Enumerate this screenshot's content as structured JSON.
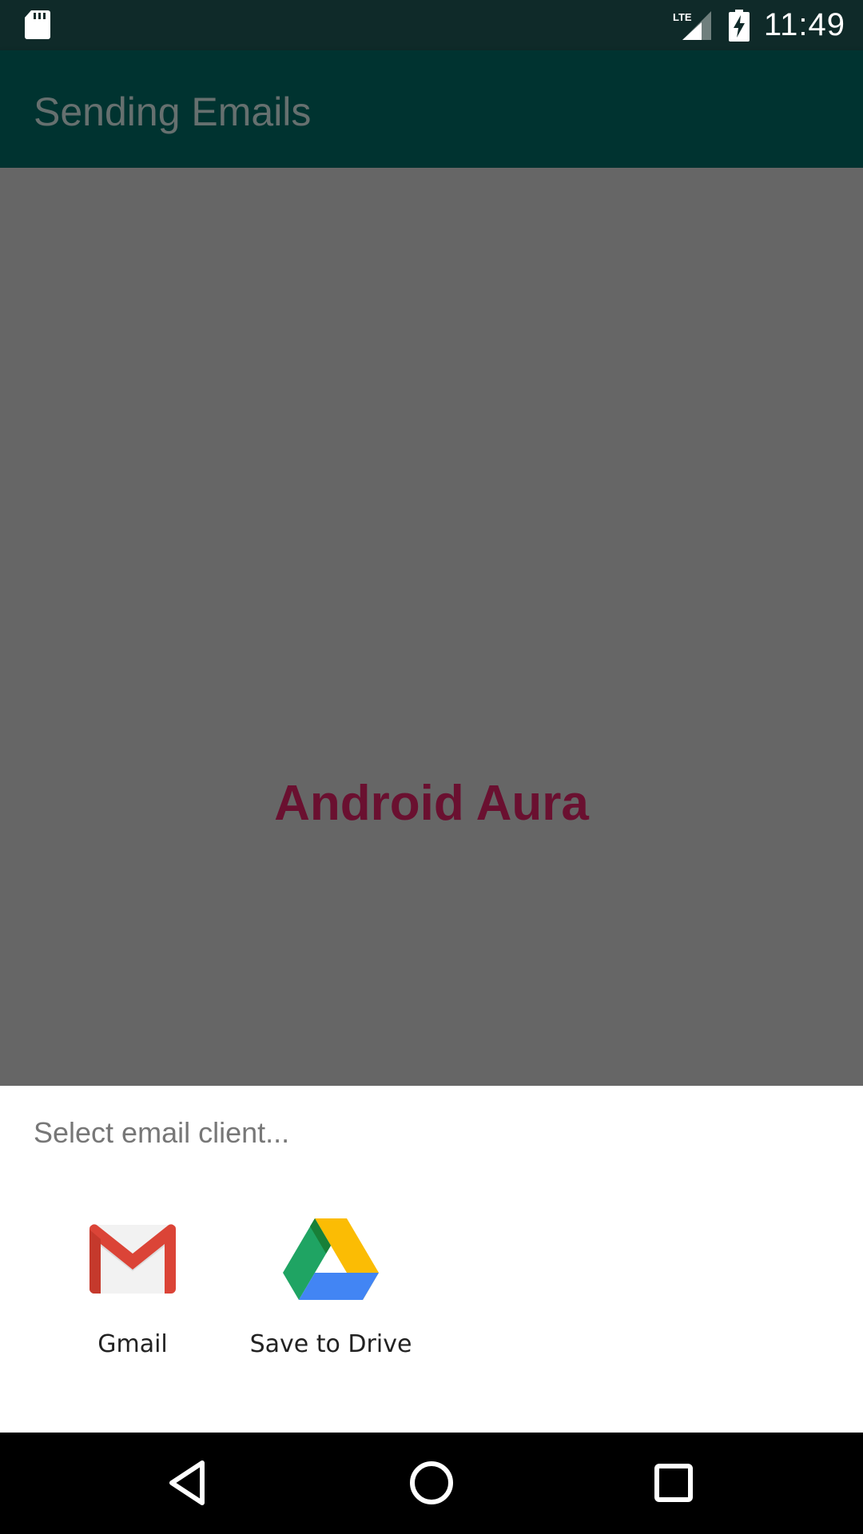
{
  "status_bar": {
    "time": "11:49",
    "network": "LTE",
    "icons": [
      "sd-card-icon",
      "lte-signal-icon",
      "battery-charging-icon"
    ]
  },
  "app_bar": {
    "title": "Sending Emails"
  },
  "content": {
    "label": "Android Aura"
  },
  "chooser": {
    "title": "Select email client...",
    "options": [
      {
        "label": "Gmail",
        "icon": "gmail-icon"
      },
      {
        "label": "Save to Drive",
        "icon": "drive-icon"
      }
    ]
  },
  "nav_bar": {
    "buttons": [
      "back-icon",
      "home-icon",
      "recents-icon"
    ]
  },
  "colors": {
    "status_bar": "#0f2a29",
    "app_bar": "#003330",
    "scrim": "#666666",
    "content_label": "#6a1030",
    "sheet": "#ffffff",
    "nav_bar": "#000000"
  }
}
